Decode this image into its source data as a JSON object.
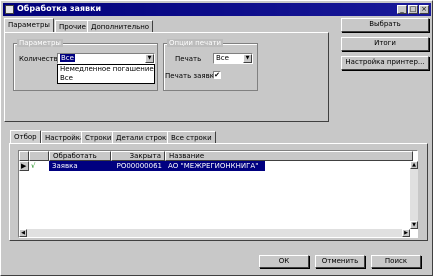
{
  "window": {
    "title": "Обработка заявки"
  },
  "top_tabs": [
    "Параметры",
    "Прочие",
    "Дополнительно"
  ],
  "params_group": {
    "title": "Параметры",
    "quantity_label": "Количество",
    "quantity_value": "Все",
    "dropdown_options": [
      "Немедленное погашение",
      "Все"
    ]
  },
  "print_group": {
    "title": "Опции печати",
    "print_label": "Печать",
    "print_value": "Все",
    "print_request_label": "Печать заявки",
    "print_request_checked": "✔"
  },
  "side_buttons": {
    "select": "Выбрать",
    "totals": "Итоги",
    "printer_setup": "Настройка принтер..."
  },
  "bottom_tabs": [
    "Отбор",
    "Настройка",
    "Строки",
    "Детали строки",
    "Все строки"
  ],
  "grid": {
    "columns": [
      "Обработать",
      "Закрыта",
      "Название"
    ],
    "rows": [
      {
        "marker": "▶",
        "check": "√",
        "process": "Заявка",
        "closed": "РО00000061",
        "name": "АО \"МЕЖРЕГИОНКНИГА\""
      }
    ]
  },
  "footer_buttons": {
    "ok": "ОК",
    "cancel": "Отменить",
    "search": "Поиск"
  }
}
